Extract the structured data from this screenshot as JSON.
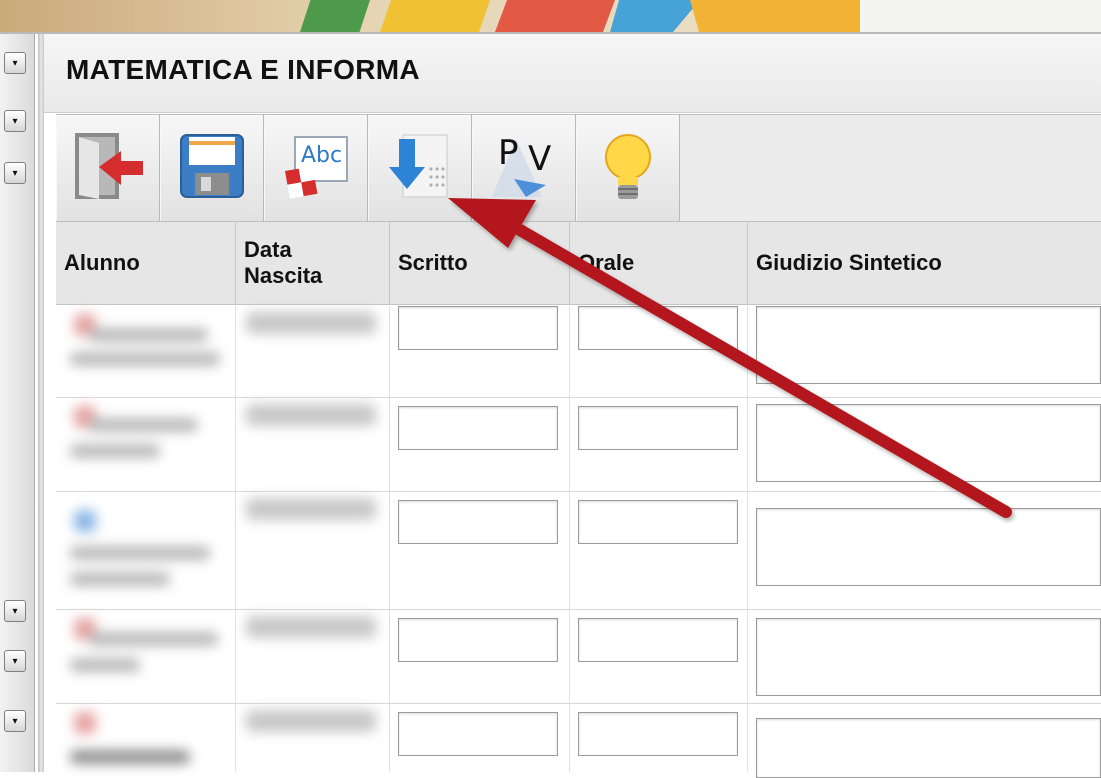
{
  "panel": {
    "title": "MATEMATICA E INFORMA"
  },
  "toolbar": {
    "buttons": [
      {
        "name": "exit-button",
        "icon": "exit-door-icon"
      },
      {
        "name": "save-button",
        "icon": "floppy-disk-icon"
      },
      {
        "name": "spellcheck-button",
        "icon": "abc-checker-icon"
      },
      {
        "name": "import-down-button",
        "icon": "download-arrow-icon"
      },
      {
        "name": "pv-button",
        "icon": "pv-icon"
      },
      {
        "name": "hint-button",
        "icon": "lightbulb-icon"
      }
    ],
    "pv_letters": {
      "p": "P",
      "v": "V"
    },
    "abc_text": "Abc"
  },
  "table": {
    "columns": {
      "alunno": "Alunno",
      "data_nascita_1": "Data",
      "data_nascita_2": "Nascita",
      "scritto": "Scritto",
      "orale": "Orale",
      "giudizio": "Giudizio Sintetico"
    },
    "rows": [
      {
        "scritto": "",
        "orale": "",
        "giudizio": ""
      },
      {
        "scritto": "",
        "orale": "",
        "giudizio": ""
      },
      {
        "scritto": "",
        "orale": "",
        "giudizio": ""
      },
      {
        "scritto": "",
        "orale": "",
        "giudizio": ""
      },
      {
        "scritto": "",
        "orale": "",
        "giudizio": ""
      }
    ]
  },
  "colors": {
    "arrow": "#b3161c",
    "header_bg": "#e6e6e6",
    "toolbar_bg": "#ececec"
  }
}
